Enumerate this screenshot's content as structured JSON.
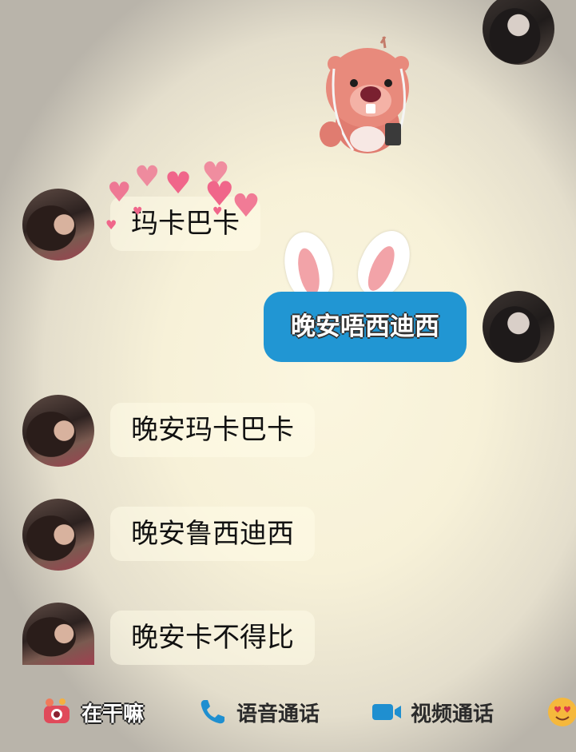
{
  "messages": [
    {
      "side": "received",
      "text": "玛卡巴卡"
    },
    {
      "side": "sent",
      "text": "晚安唔西迪西"
    },
    {
      "side": "received",
      "text": "晚安玛卡巴卡"
    },
    {
      "side": "received",
      "text": "晚安鲁西迪西"
    },
    {
      "side": "received",
      "text": "晚安卡不得比"
    }
  ],
  "toolbar": {
    "doing_label": "在干嘛",
    "voice_call_label": "语音通话",
    "video_call_label": "视频通话"
  },
  "colors": {
    "sent_bubble": "#2196d3",
    "phone_icon": "#1f8fd0",
    "video_icon": "#1f8fd0",
    "hearts": "#f0668a"
  },
  "icons": [
    "avatar",
    "beaver-sticker",
    "hearts-decoration",
    "bunny-ears-decoration",
    "camera-sticker-icon",
    "phone-icon",
    "video-camera-icon",
    "emoji-heart-eyes-icon"
  ]
}
